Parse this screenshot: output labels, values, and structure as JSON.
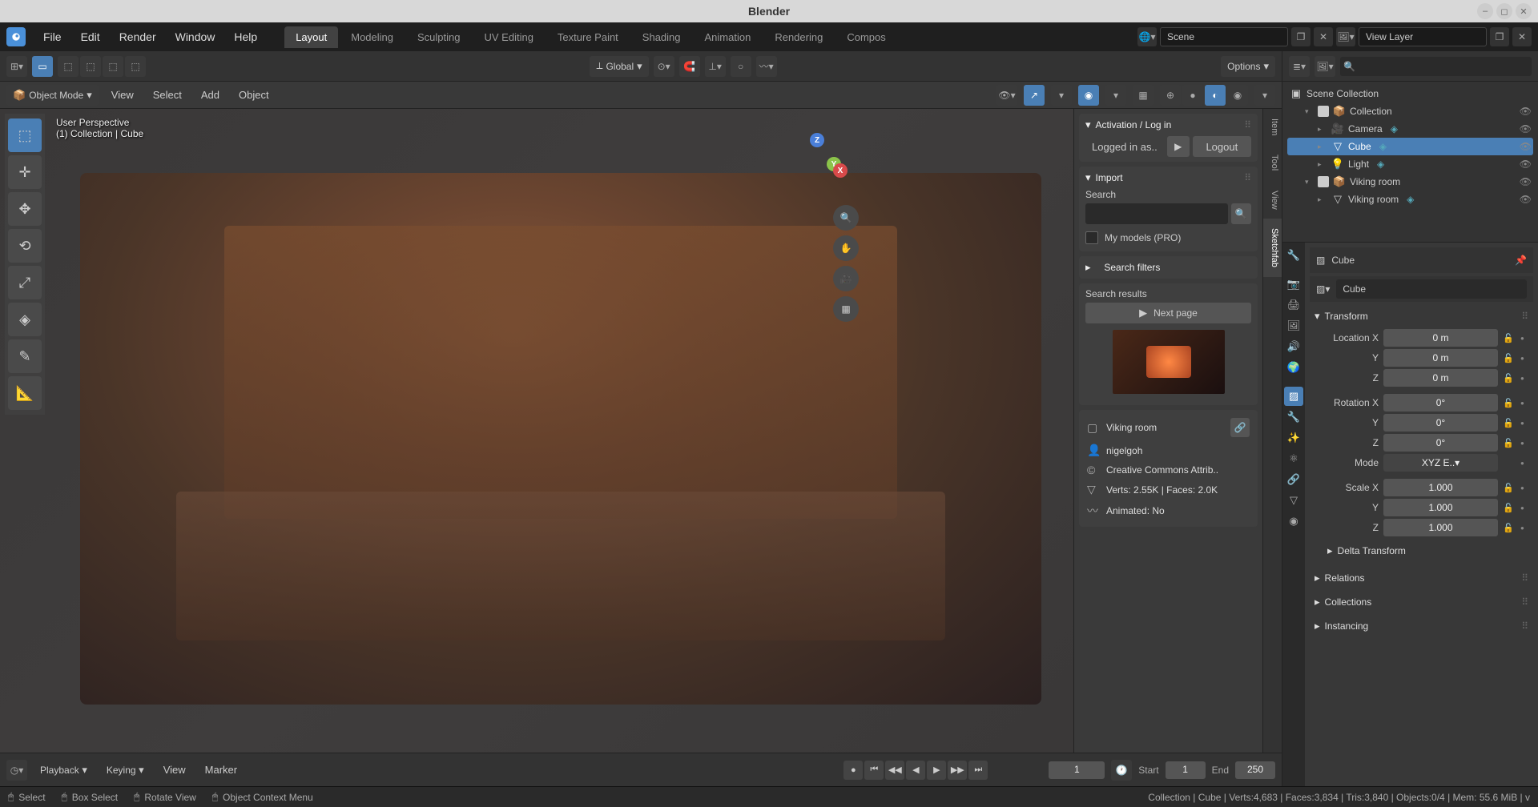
{
  "title": "Blender",
  "menus": [
    "File",
    "Edit",
    "Render",
    "Window",
    "Help"
  ],
  "workspace_tabs": [
    "Layout",
    "Modeling",
    "Sculpting",
    "UV Editing",
    "Texture Paint",
    "Shading",
    "Animation",
    "Rendering",
    "Compos"
  ],
  "active_workspace": "Layout",
  "scene_name": "Scene",
  "view_layer": "View Layer",
  "vp_header": {
    "orientation": "Global",
    "options": "Options"
  },
  "vp_header2": {
    "mode": "Object Mode",
    "menus": [
      "View",
      "Select",
      "Add",
      "Object"
    ]
  },
  "vp_info": {
    "line1": "User Perspective",
    "line2": "(1) Collection | Cube"
  },
  "n_tabs": [
    "Item",
    "Tool",
    "View",
    "Sketchfab"
  ],
  "n_panel": {
    "activation_hdr": "Activation / Log in",
    "logged_in": "Logged in as..",
    "logout": "Logout",
    "import_hdr": "Import",
    "search_lbl": "Search",
    "my_models": "My models (PRO)",
    "filters": "Search filters",
    "results_hdr": "Search results",
    "next": "Next page",
    "info_name": "Viking room",
    "info_author": "nigelgoh",
    "info_license": "Creative Commons Attrib..",
    "info_stats": "Verts: 2.55K  |  Faces: 2.0K",
    "info_anim": "Animated: No"
  },
  "outliner": {
    "root": "Scene Collection",
    "items": [
      {
        "name": "Collection",
        "indent": 1,
        "tw": "▾",
        "chk": true,
        "icon": "📦",
        "vis": "👁"
      },
      {
        "name": "Camera",
        "indent": 2,
        "tw": "▸",
        "chk": false,
        "icon": "🎥",
        "vis": "👁",
        "badge": true
      },
      {
        "name": "Cube",
        "indent": 2,
        "tw": "▸",
        "chk": false,
        "icon": "▽",
        "vis": "👁",
        "active": true,
        "badge": true
      },
      {
        "name": "Light",
        "indent": 2,
        "tw": "▸",
        "chk": false,
        "icon": "💡",
        "vis": "👁",
        "badge": true
      },
      {
        "name": "Viking room",
        "indent": 1,
        "tw": "▾",
        "chk": true,
        "icon": "📦",
        "vis": "👁"
      },
      {
        "name": "Viking room",
        "indent": 2,
        "tw": "▸",
        "chk": false,
        "icon": "▽",
        "vis": "👁",
        "badge": true
      }
    ]
  },
  "props": {
    "breadcrumb": "Cube",
    "name_field": "Cube",
    "transform_hdr": "Transform",
    "loc_label": "Location X",
    "rot_label": "Rotation X",
    "scale_label": "Scale X",
    "mode_label": "Mode",
    "mode_val": "XYZ E..▾",
    "loc": [
      "0 m",
      "0 m",
      "0 m"
    ],
    "rot": [
      "0°",
      "0°",
      "0°"
    ],
    "scale": [
      "1.000",
      "1.000",
      "1.000"
    ],
    "delta": "Delta Transform",
    "relations": "Relations",
    "collections": "Collections",
    "instancing": "Instancing"
  },
  "timeline": {
    "menus": [
      "Playback",
      "Keying",
      "View",
      "Marker"
    ],
    "current": "1",
    "start_lbl": "Start",
    "start": "1",
    "end_lbl": "End",
    "end": "250"
  },
  "status": {
    "select": "Select",
    "box": "Box Select",
    "rotate": "Rotate View",
    "ctx": "Object Context Menu",
    "info": "Collection | Cube | Verts:4,683 | Faces:3,834 | Tris:3,840 | Objects:0/4 | Mem: 55.6 MiB | v"
  }
}
